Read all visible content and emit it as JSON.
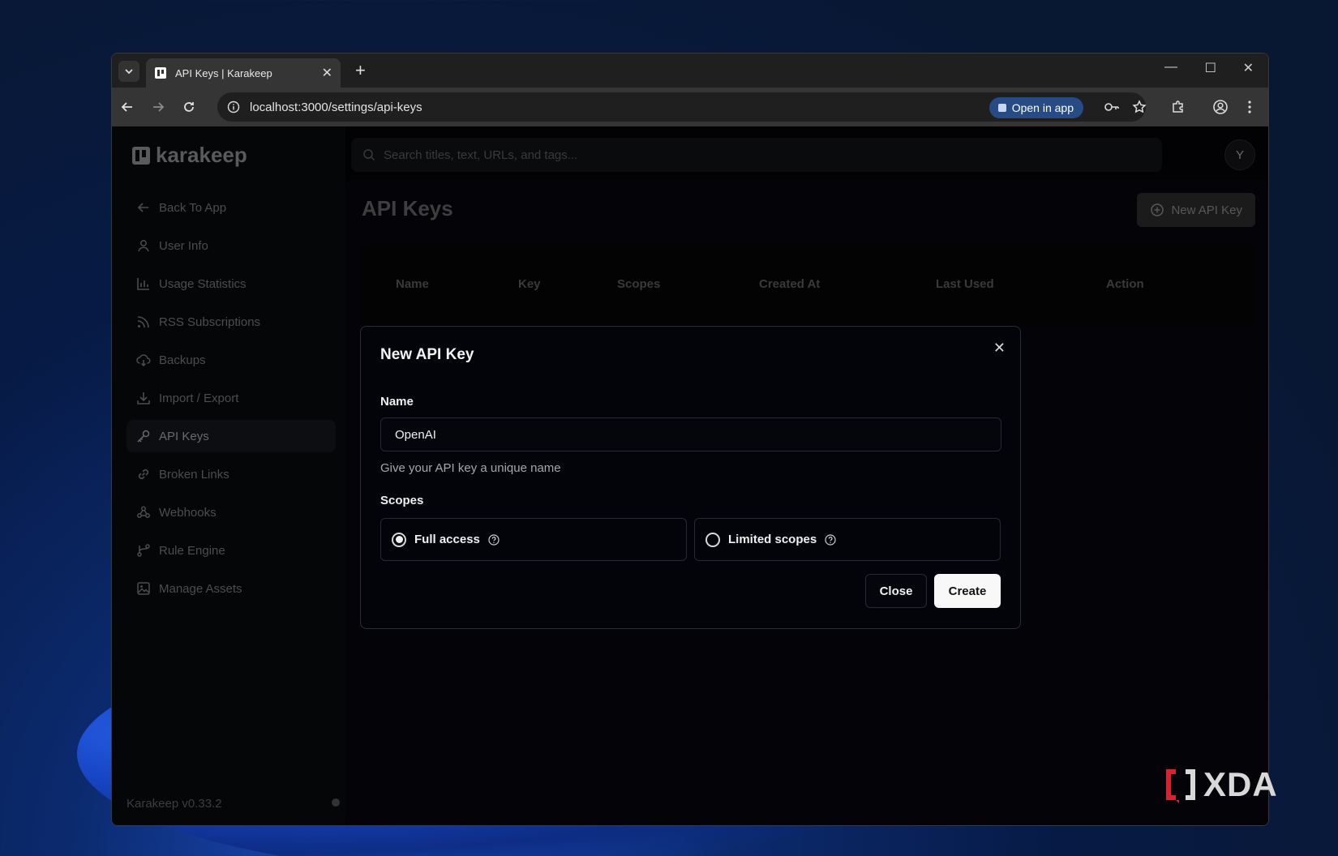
{
  "browser": {
    "tab_title": "API Keys | Karakeep",
    "url": "localhost:3000/settings/api-keys",
    "open_in_app": "Open in app"
  },
  "app": {
    "logo_text": "karakeep",
    "search_placeholder": "Search titles, text, URLs, and tags...",
    "avatar_initial": "Y",
    "version": "Karakeep v0.33.2"
  },
  "sidebar": {
    "items": [
      {
        "label": "Back To App",
        "icon": "arrow-left-icon"
      },
      {
        "label": "User Info",
        "icon": "user-icon"
      },
      {
        "label": "Usage Statistics",
        "icon": "bar-chart-icon"
      },
      {
        "label": "RSS Subscriptions",
        "icon": "rss-icon"
      },
      {
        "label": "Backups",
        "icon": "cloud-download-icon"
      },
      {
        "label": "Import / Export",
        "icon": "download-icon"
      },
      {
        "label": "API Keys",
        "icon": "key-icon",
        "active": true
      },
      {
        "label": "Broken Links",
        "icon": "link-icon"
      },
      {
        "label": "Webhooks",
        "icon": "webhook-icon"
      },
      {
        "label": "Rule Engine",
        "icon": "branch-icon"
      },
      {
        "label": "Manage Assets",
        "icon": "image-icon"
      }
    ]
  },
  "page": {
    "title": "API Keys",
    "new_key_button": "New API Key",
    "table_headers": [
      "Name",
      "Key",
      "Scopes",
      "Created At",
      "Last Used",
      "Action"
    ]
  },
  "modal": {
    "title": "New API Key",
    "name_label": "Name",
    "name_value": "OpenAI",
    "name_hint": "Give your API key a unique name",
    "scopes_label": "Scopes",
    "scope_full": "Full access",
    "scope_limited": "Limited scopes",
    "selected_scope": "Full access",
    "close_button": "Close",
    "create_button": "Create"
  },
  "watermark": "XDA"
}
